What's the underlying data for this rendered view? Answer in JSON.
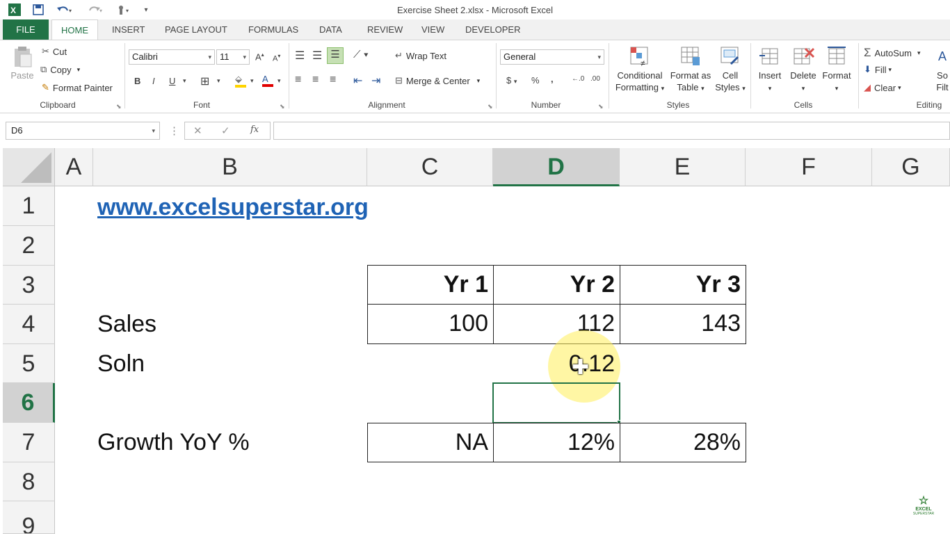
{
  "window": {
    "title": "Exercise Sheet 2.xlsx - Microsoft Excel"
  },
  "quick_access": {
    "icons": [
      "excel-logo-icon",
      "save-icon",
      "undo-icon",
      "redo-icon",
      "touch-mode-icon",
      "customize-icon"
    ]
  },
  "tabs": [
    "FILE",
    "HOME",
    "INSERT",
    "PAGE LAYOUT",
    "FORMULAS",
    "DATA",
    "REVIEW",
    "VIEW",
    "DEVELOPER"
  ],
  "ribbon": {
    "clipboard": {
      "paste": "Paste",
      "cut": "Cut",
      "copy": "Copy",
      "format_painter": "Format Painter",
      "label": "Clipboard"
    },
    "font": {
      "name": "Calibri",
      "size": "11",
      "bold": "B",
      "italic": "I",
      "underline": "U",
      "label": "Font"
    },
    "alignment": {
      "wrap_text": "Wrap Text",
      "merge_center": "Merge & Center",
      "label": "Alignment"
    },
    "number": {
      "format": "General",
      "label": "Number"
    },
    "styles": {
      "conditional_1": "Conditional",
      "conditional_2": "Formatting",
      "format_table_1": "Format as",
      "format_table_2": "Table",
      "cell_styles_1": "Cell",
      "cell_styles_2": "Styles",
      "label": "Styles"
    },
    "cells": {
      "insert": "Insert",
      "delete": "Delete",
      "format": "Format",
      "label": "Cells"
    },
    "editing": {
      "autosum": "AutoSum",
      "fill": "Fill",
      "clear": "Clear",
      "sort_1": "So",
      "sort_2": "Filt",
      "label": "Editing"
    }
  },
  "formula_bar": {
    "name_box": "D6",
    "fx": "fx",
    "value": ""
  },
  "columns": [
    "A",
    "B",
    "C",
    "D",
    "E",
    "F",
    "G"
  ],
  "rows": [
    "1",
    "2",
    "3",
    "4",
    "5",
    "6",
    "7",
    "8",
    "9"
  ],
  "selected": {
    "column": "D",
    "row": "6"
  },
  "cells": {
    "B1": "www.excelsuperstar.org",
    "C3": "Yr 1",
    "D3": "Yr 2",
    "E3": "Yr 3",
    "B4": "Sales",
    "C4": "100",
    "D4": "112",
    "E4": "143",
    "B5": "Soln",
    "D5": "0.12",
    "B7": "Growth YoY %",
    "C7": "NA",
    "D7": "12%",
    "E7": "28%"
  },
  "watermark": {
    "line1": "EXCEL",
    "line2": "SUPERSTAR"
  },
  "colors": {
    "excel_green": "#217346",
    "link_blue": "#1f63b5"
  }
}
